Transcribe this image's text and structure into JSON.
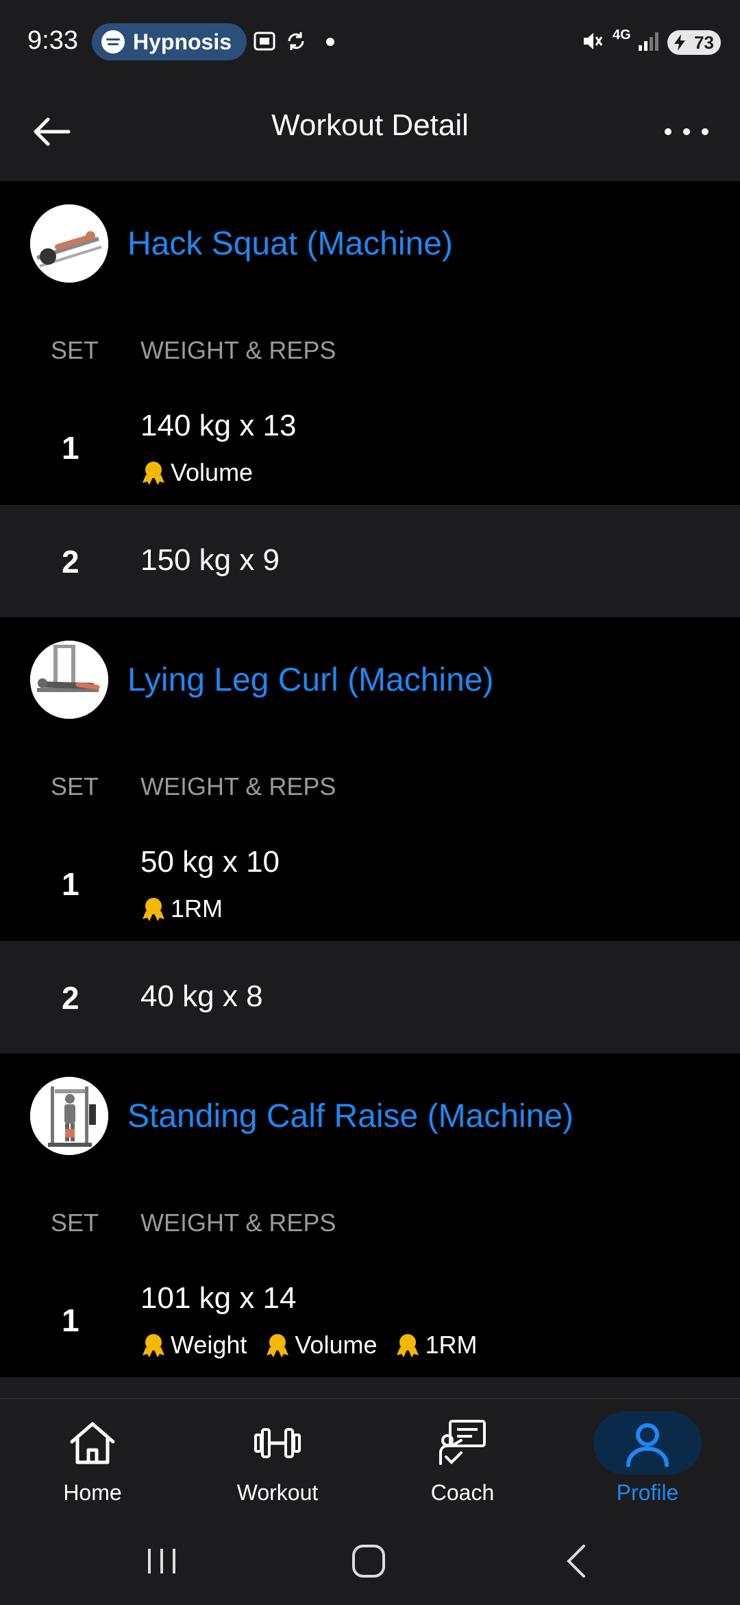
{
  "status_bar": {
    "time": "9:33",
    "media_app": "Hypnosis",
    "network": "4G",
    "battery": "73"
  },
  "app_bar": {
    "title": "Workout Detail",
    "back_icon": "arrow-left-icon",
    "more_icon": "more-horizontal-icon"
  },
  "colors": {
    "accent": "#1e88f5",
    "background": "#000000",
    "surface": "#1c1c1e",
    "muted_text": "#9a9a9a",
    "medal": "#f5b800"
  },
  "exercises": [
    {
      "name": "Hack Squat (Machine)",
      "col_set": "SET",
      "col_weight_reps": "WEIGHT & REPS",
      "sets": [
        {
          "number": "1",
          "value": "140 kg x 13",
          "records": [
            "Volume"
          ]
        },
        {
          "number": "2",
          "value": "150 kg x 9",
          "records": []
        }
      ]
    },
    {
      "name": "Lying Leg Curl (Machine)",
      "col_set": "SET",
      "col_weight_reps": "WEIGHT & REPS",
      "sets": [
        {
          "number": "1",
          "value": "50 kg x 10",
          "records": [
            "1RM"
          ]
        },
        {
          "number": "2",
          "value": "40 kg x 8",
          "records": []
        }
      ]
    },
    {
      "name": "Standing Calf Raise (Machine)",
      "col_set": "SET",
      "col_weight_reps": "WEIGHT & REPS",
      "sets": [
        {
          "number": "1",
          "value": "101 kg x 14",
          "records": [
            "Weight",
            "Volume",
            "1RM"
          ]
        }
      ]
    }
  ],
  "bottom_nav": {
    "items": [
      {
        "label": "Home",
        "icon": "home-icon",
        "active": false
      },
      {
        "label": "Workout",
        "icon": "dumbbell-icon",
        "active": false
      },
      {
        "label": "Coach",
        "icon": "coach-icon",
        "active": false
      },
      {
        "label": "Profile",
        "icon": "profile-icon",
        "active": true
      }
    ]
  }
}
